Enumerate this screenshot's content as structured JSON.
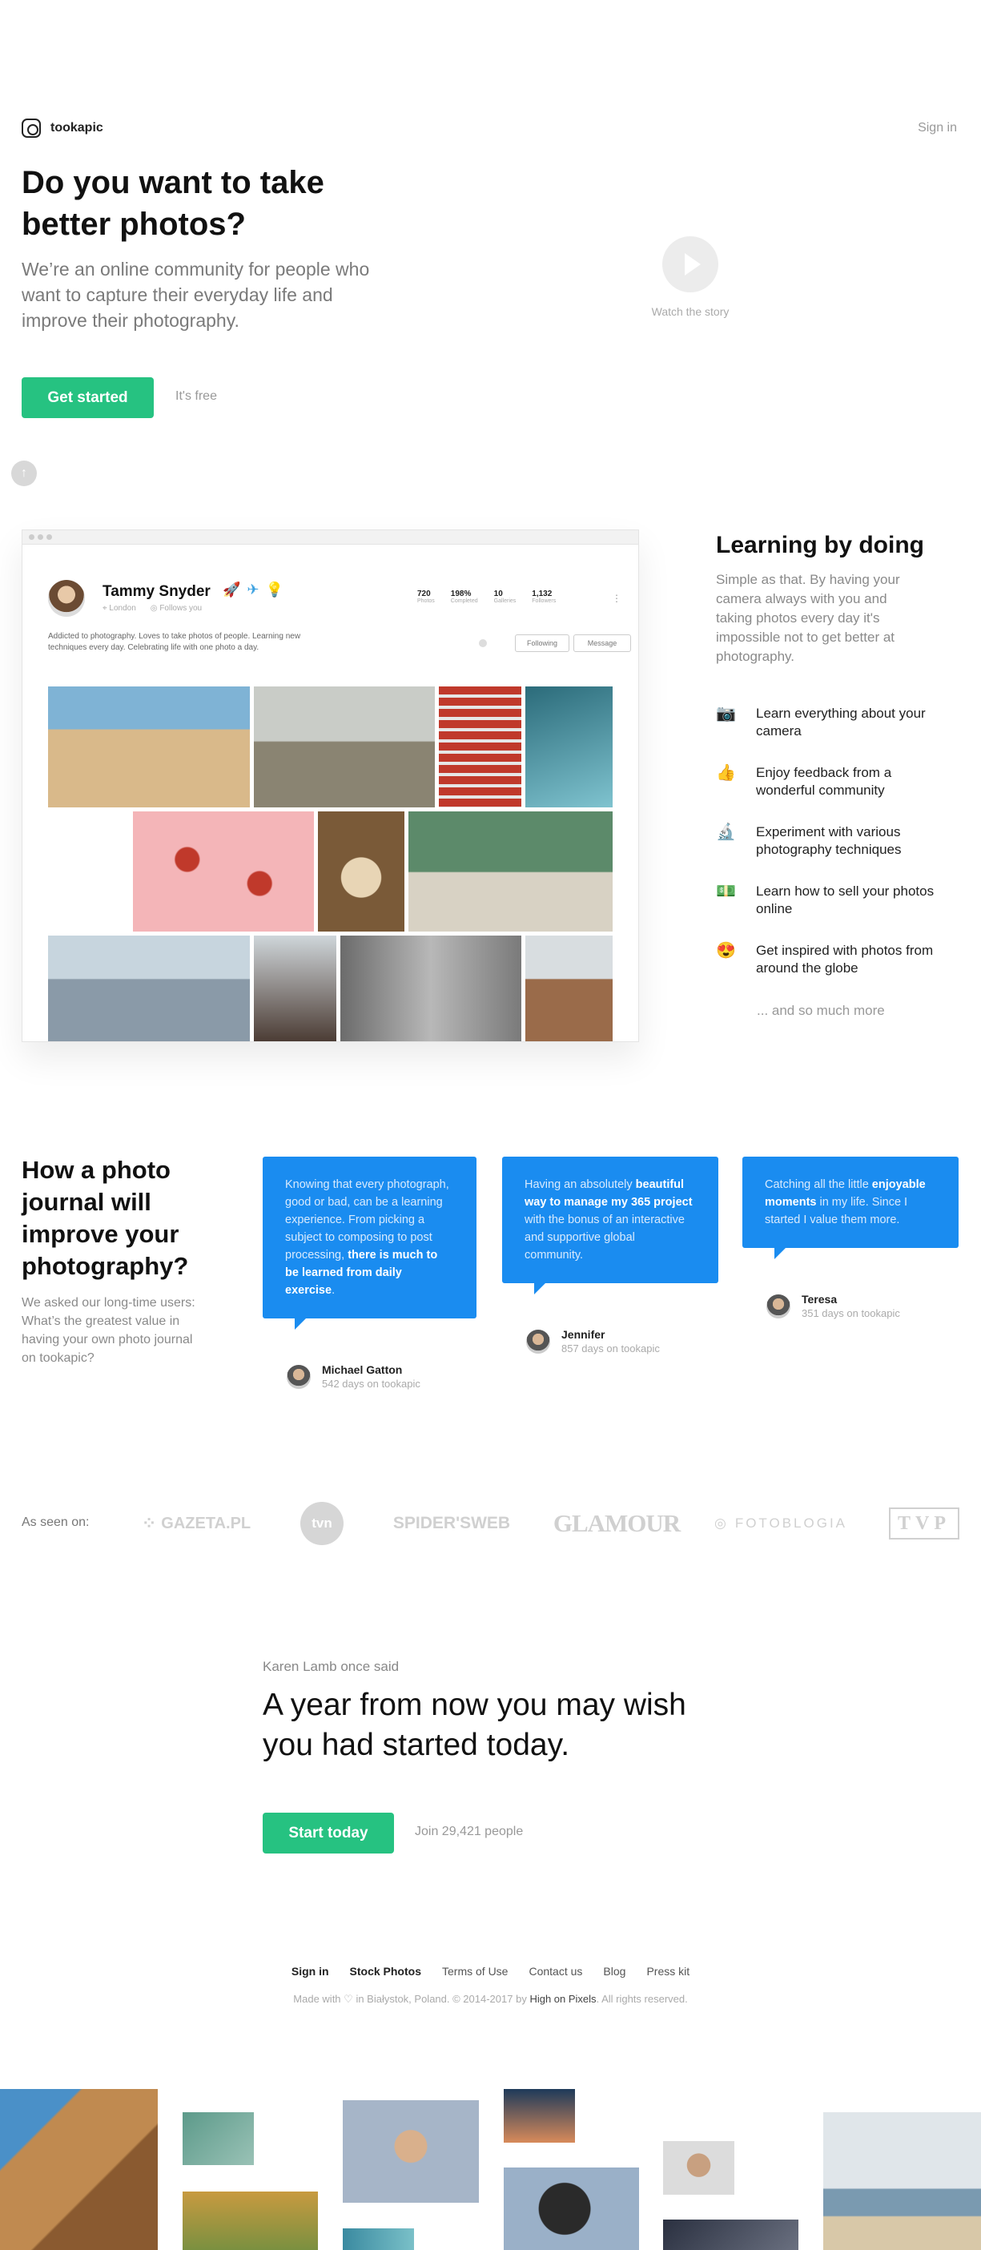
{
  "header": {
    "brand": "tookapic",
    "signin": "Sign in"
  },
  "hero": {
    "title": "Do you want to take better photos?",
    "subtitle": "We’re an online community for people who want to capture their everyday life and improve their photography.",
    "cta": "Get started",
    "cta_note": "It's free",
    "watch": "Watch the story"
  },
  "profile": {
    "name": "Tammy Snyder",
    "location": "London",
    "follows": "Follows you",
    "bio": "Addicted to photography. Loves to take photos of people. Learning new techniques every day. Celebrating life with one photo a day.",
    "stats": [
      {
        "value": "720",
        "label": "Photos"
      },
      {
        "value": "198%",
        "label": "Completed"
      },
      {
        "value": "10",
        "label": "Galleries"
      },
      {
        "value": "1,132",
        "label": "Followers"
      }
    ],
    "following_btn": "Following",
    "message_btn": "Message"
  },
  "learning": {
    "title": "Learning by doing",
    "subtitle": "Simple as that. By having your camera always with you and taking photos every day it's impossible not to get better at photography.",
    "features": [
      {
        "icon": "📷",
        "label": "Learn everything about your camera"
      },
      {
        "icon": "👍",
        "label": "Enjoy feedback from a wonderful community"
      },
      {
        "icon": "🔬",
        "label": "Experiment with various photography techniques"
      },
      {
        "icon": "💵",
        "label": "Learn how to sell your photos online"
      },
      {
        "icon": "😍",
        "label": "Get inspired with photos from around the globe"
      }
    ],
    "more": "... and so much more"
  },
  "testimonials": {
    "title": "How a photo journal will improve your photography?",
    "subtitle": "We asked our long-time users: What’s the greatest value in having your own photo journal on tookapic?",
    "items": [
      {
        "before": "Knowing that every photograph, good or bad, can be a learning experience. From picking a subject to composing to post processing, ",
        "bold": "there is much to be learned from daily exercise",
        "after": ".",
        "name": "Michael Gatton",
        "days": "542 days on tookapic"
      },
      {
        "before": "Having an absolutely ",
        "bold": "beautiful way to manage my 365 project",
        "after": " with the bonus of an interactive and supportive global community.",
        "name": "Jennifer",
        "days": "857 days on tookapic"
      },
      {
        "before": "Catching all the little ",
        "bold": "enjoyable moments",
        "after": " in my life. Since I started I value them more.",
        "name": "Teresa",
        "days": "351 days on tookapic"
      }
    ]
  },
  "press": {
    "label": "As seen on:",
    "logos": [
      "GAZETA.PL",
      "tvn",
      "SPIDER'SWEB",
      "GLAMOUR",
      "FOTOBLOGIA",
      "TVP"
    ]
  },
  "quote": {
    "author": "Karen Lamb once said",
    "text": "A year from now you may wish you had started today.",
    "cta": "Start today",
    "join": "Join 29,421 people"
  },
  "footer": {
    "links": [
      "Sign in",
      "Stock Photos",
      "Terms of Use",
      "Contact us",
      "Blog",
      "Press kit"
    ],
    "made_with": "Made with",
    "location": "in Białystok, Poland. © 2014-2017 by",
    "company": "High on Pixels",
    "rights": ". All rights reserved."
  }
}
